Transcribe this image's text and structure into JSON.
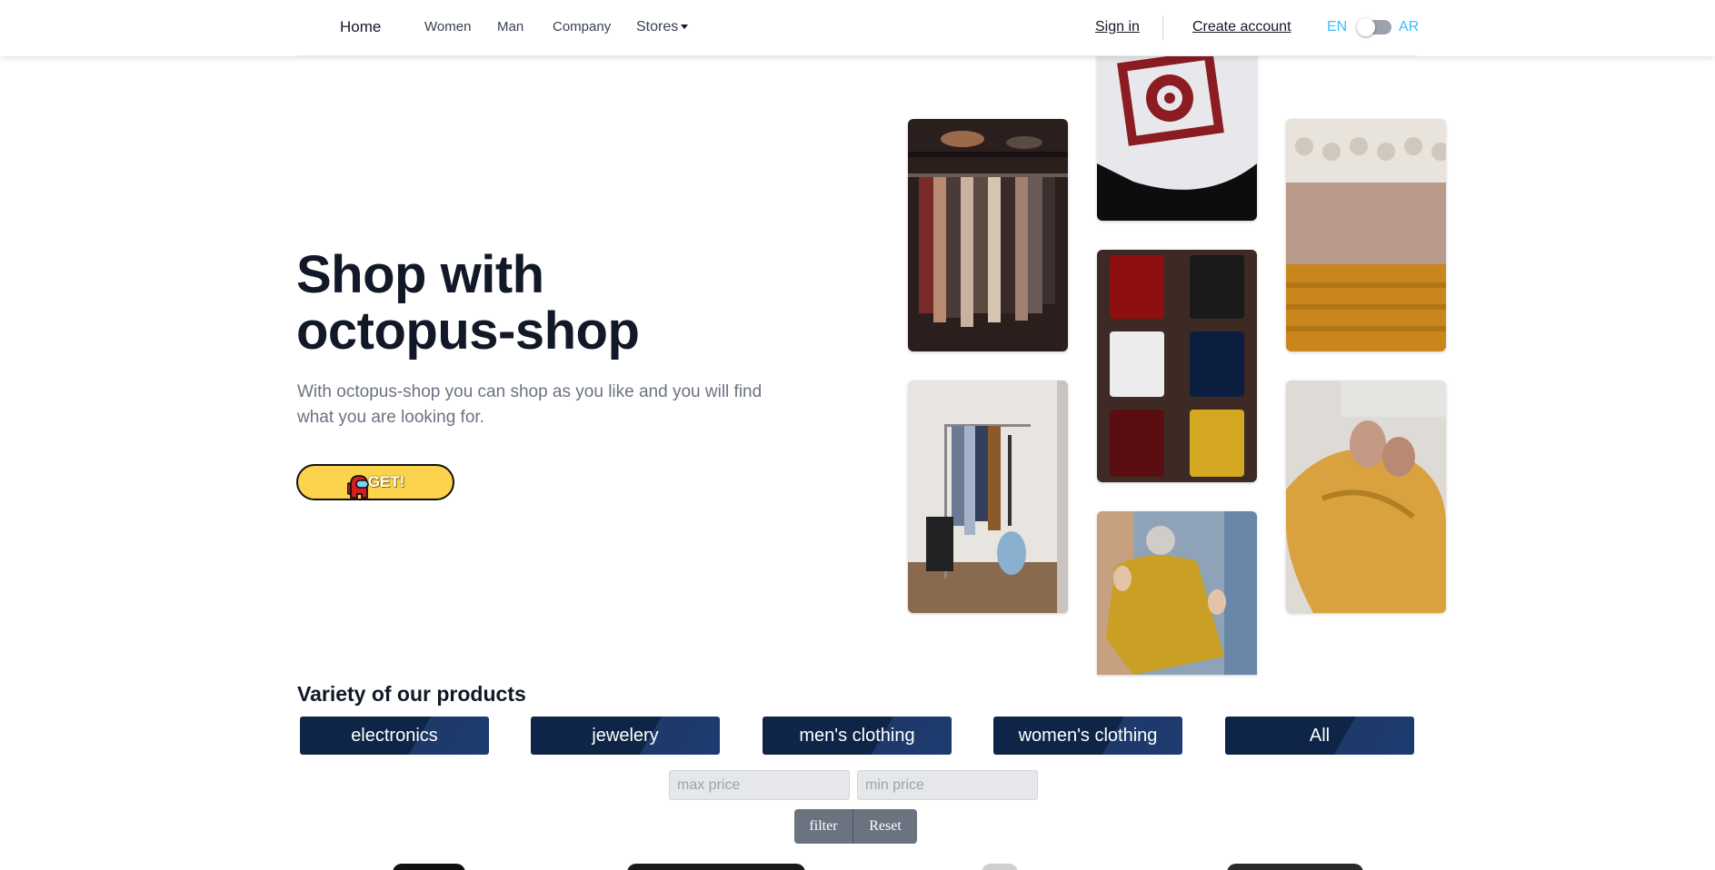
{
  "nav": {
    "home": "Home",
    "women": "Women",
    "man": "Man",
    "company": "Company",
    "stores": "Stores",
    "sign_in": "Sign in",
    "create_account": "Create account",
    "lang_en": "EN",
    "lang_ar": "AR"
  },
  "hero": {
    "title": "Shop with octopus-shop",
    "subtitle": "With octopus-shop you can shop as you like and you will find what you are looking for.",
    "cta": "GET!"
  },
  "products": {
    "title": "Variety of our products",
    "categories": [
      "electronics",
      "jewelery",
      "men's clothing",
      "women's clothing",
      "All"
    ],
    "max_price_placeholder": "max price",
    "min_price_placeholder": "min price",
    "filter_label": "filter",
    "reset_label": "Reset"
  },
  "colors": {
    "accent": "#38bdf8",
    "category_bg": "#0f2547",
    "cta_bg": "#fcd34d",
    "filter_bg": "#6b7280"
  }
}
